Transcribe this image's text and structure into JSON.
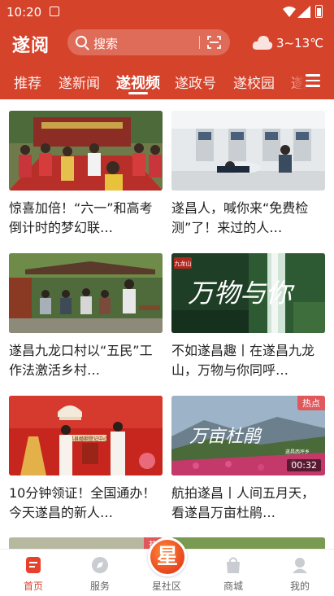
{
  "status_bar": {
    "time": "10:20"
  },
  "header": {
    "logo_text": "遂阅",
    "search": {
      "placeholder": "搜索"
    },
    "weather": {
      "text": "3~13℃"
    },
    "tabs": [
      {
        "label": "推荐",
        "active": false
      },
      {
        "label": "遂新闻",
        "active": false
      },
      {
        "label": "遂视频",
        "active": true
      },
      {
        "label": "遂政号",
        "active": false
      },
      {
        "label": "遂校园",
        "active": false
      },
      {
        "label": "遂",
        "active": false
      }
    ]
  },
  "videos": [
    {
      "title": "惊喜加倍！“六一”和高考倒计时的梦幻联…"
    },
    {
      "title": "遂昌人，喊你来“免费检测”了！来过的人…"
    },
    {
      "title": "遂昌九龙口村以“五民”工作法激活乡村…"
    },
    {
      "title": "不如遂昌趣丨在遂昌九龙山，万物与你同呼…"
    },
    {
      "title": "10分钟领证！全国通办！今天遂昌的新人…"
    },
    {
      "title": "航拍遂昌丨人间五月天，看遂昌万亩杜鹃…",
      "badge": "热点",
      "duration": "00:32"
    }
  ],
  "partial_row": {
    "badge": "热"
  },
  "thumb_overlays": {
    "v4_title": "万物与你",
    "v4_seal": "九龙山",
    "v5_banner": "遂昌县婚姻登记中心",
    "v6_title": "万亩杜鹃",
    "v6_sub": "遂昌西坪乡"
  },
  "bottom_nav": [
    {
      "label": "首页",
      "active": true
    },
    {
      "label": "服务",
      "active": false
    },
    {
      "label": "星社区",
      "active": false,
      "badge": "星"
    },
    {
      "label": "商城",
      "active": false
    },
    {
      "label": "我的",
      "active": false
    }
  ],
  "colors": {
    "brand": "#d6432b",
    "text": "#222222",
    "nav_inactive": "#666666"
  }
}
